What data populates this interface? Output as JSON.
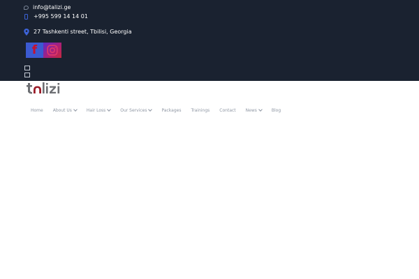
{
  "topbar": {
    "email": "info@talizi.ge",
    "phone": "+995 599 14 14 01",
    "address": "27 Tashkenti street, Tbilisi, Georgia",
    "background_color": "#1a2230",
    "icons": {
      "email": "chat-bubble-icon",
      "phone": "mobile-phone-icon",
      "address": "map-pin-icon"
    },
    "social": {
      "facebook_glyph": "f",
      "facebook_color": "#3b5ad1",
      "instagram_icon": "instagram-icon"
    }
  },
  "brand": {
    "logo_text": "talizi",
    "accent_color": "#9b1d2a",
    "gray_color": "#6d6f73"
  },
  "nav": {
    "items": [
      {
        "label": "Home",
        "dropdown": false
      },
      {
        "label": "About Us",
        "dropdown": true
      },
      {
        "label": "Hair Loss",
        "dropdown": true
      },
      {
        "label": "Our Services",
        "dropdown": true
      },
      {
        "label": "Packages",
        "dropdown": false
      },
      {
        "label": "Trainings",
        "dropdown": false
      },
      {
        "label": "Contact",
        "dropdown": false
      },
      {
        "label": "News",
        "dropdown": true
      },
      {
        "label": "Blog",
        "dropdown": false
      }
    ]
  }
}
